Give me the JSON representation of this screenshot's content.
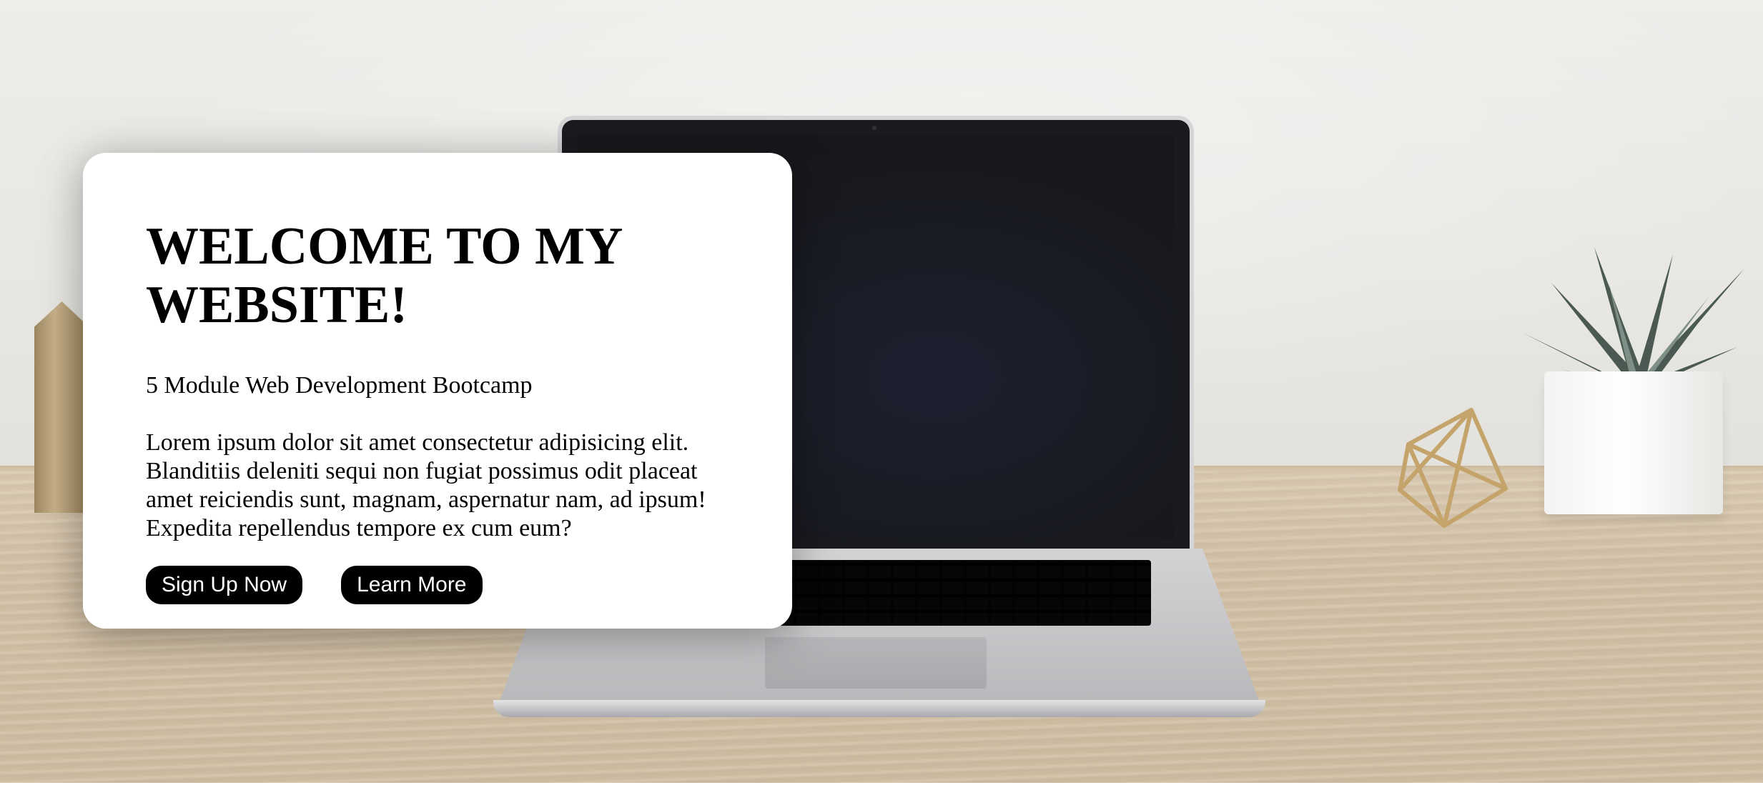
{
  "hero": {
    "title": "WELCOME TO MY WEBSITE!",
    "subtitle": "5 Module Web Development Bootcamp",
    "description": "Lorem ipsum dolor sit amet consectetur adipisicing elit. Blanditiis deleniti sequi non fugiat possimus odit placeat amet reiciendis sunt, magnam, aspernatur nam, ad ipsum! Expedita repellendus tempore ex cum eum?",
    "buttons": {
      "primary_label": "Sign Up Now",
      "secondary_label": "Learn More"
    }
  },
  "colors": {
    "card_background": "#ffffff",
    "button_background": "#000000",
    "button_text": "#ffffff",
    "text": "#000000"
  }
}
